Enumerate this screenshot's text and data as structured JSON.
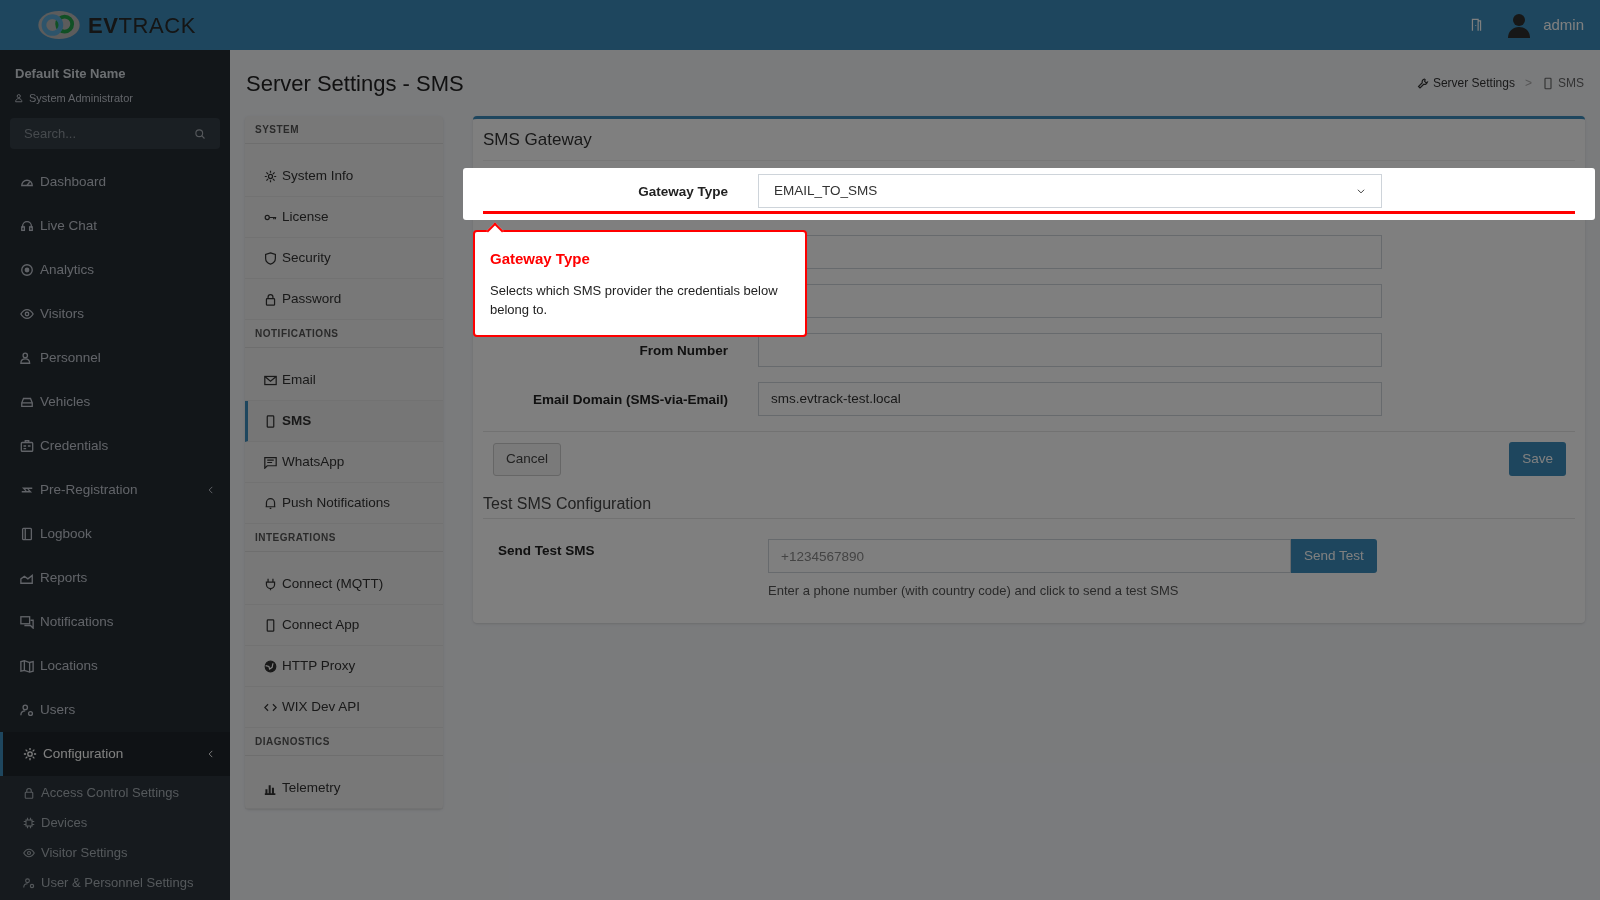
{
  "header": {
    "logo": "**EV**TRACK",
    "user": "admin"
  },
  "sidebar": {
    "site_name": "Default Site Name",
    "role": "System Administrator",
    "search": {
      "placeholder": "Search..."
    },
    "items": [
      {
        "label": "Dashboard",
        "kind": "link",
        "selected": false
      },
      {
        "label": "Live Chat",
        "kind": "link",
        "selected": false
      },
      {
        "label": "Analytics",
        "kind": "link",
        "selected": false
      },
      {
        "label": "Visitors",
        "kind": "link",
        "selected": false
      },
      {
        "label": "Personnel",
        "kind": "link",
        "selected": false
      },
      {
        "label": "Vehicles",
        "kind": "link",
        "selected": false
      },
      {
        "label": "Credentials",
        "kind": "link",
        "selected": false
      },
      {
        "label": "Pre-Registration",
        "kind": "group",
        "selected": false
      },
      {
        "label": "Logbook",
        "kind": "link",
        "selected": false
      },
      {
        "label": "Reports",
        "kind": "link",
        "selected": false
      },
      {
        "label": "Notifications",
        "kind": "link",
        "selected": false
      },
      {
        "label": "Locations",
        "kind": "link",
        "selected": false
      },
      {
        "label": "Users",
        "kind": "link",
        "selected": false
      },
      {
        "label": "Configuration",
        "kind": "group",
        "selected": true,
        "children": [
          {
            "label": "Access Control Settings",
            "selected": false
          },
          {
            "label": "Devices",
            "selected": false
          },
          {
            "label": "Visitor Settings",
            "selected": false
          },
          {
            "label": "User & Personnel Settings",
            "selected": false
          }
        ]
      }
    ]
  },
  "page": {
    "title": "Server Settings - SMS",
    "breadcrumb": [
      "Server Settings",
      ">",
      "SMS"
    ]
  },
  "settings_nav": [
    {
      "heading": "SYSTEM",
      "items": [
        {
          "label": "System Info",
          "selected": false
        },
        {
          "label": "License",
          "selected": false
        },
        {
          "label": "Security",
          "selected": false
        },
        {
          "label": "Password",
          "selected": false
        }
      ]
    },
    {
      "heading": "NOTIFICATIONS",
      "items": [
        {
          "label": "Email",
          "selected": false
        },
        {
          "label": "SMS",
          "selected": true
        },
        {
          "label": "WhatsApp",
          "selected": false
        },
        {
          "label": "Push Notifications",
          "selected": false
        }
      ]
    },
    {
      "heading": "INTEGRATIONS",
      "items": [
        {
          "label": "Connect (MQTT)",
          "selected": false
        },
        {
          "label": "Connect App",
          "selected": false
        },
        {
          "label": "HTTP Proxy",
          "selected": false
        },
        {
          "label": "WIX Dev API",
          "selected": false
        }
      ]
    },
    {
      "heading": "DIAGNOSTICS",
      "items": [
        {
          "label": "Telemetry",
          "selected": false
        }
      ]
    }
  ],
  "card": {
    "title": "SMS Gateway",
    "fields": [
      {
        "label": "Gateway Type",
        "kind": "select",
        "value": "EMAIL_TO_SMS",
        "highlighted": true
      },
      {
        "kind": "input",
        "highlighted": false
      },
      {
        "kind": "input",
        "highlighted": false
      },
      {
        "label": "From Number",
        "kind": "input",
        "highlighted": false
      },
      {
        "label": "Email Domain (SMS-via-Email)",
        "kind": "input",
        "value": "sms.evtrack-test.local",
        "highlighted": false
      }
    ],
    "cancel_button": "Cancel",
    "save_button": "Save",
    "test_section": {
      "title": "Test SMS Configuration",
      "label": "Send Test SMS",
      "placeholder": "+1234567890",
      "button": "Send Test",
      "help": "Enter a phone number (with country code) and click to send a test SMS"
    }
  },
  "tour_tooltip": {
    "title": "Gateway Type",
    "text": "Selects which SMS provider the credentials below belong to."
  }
}
